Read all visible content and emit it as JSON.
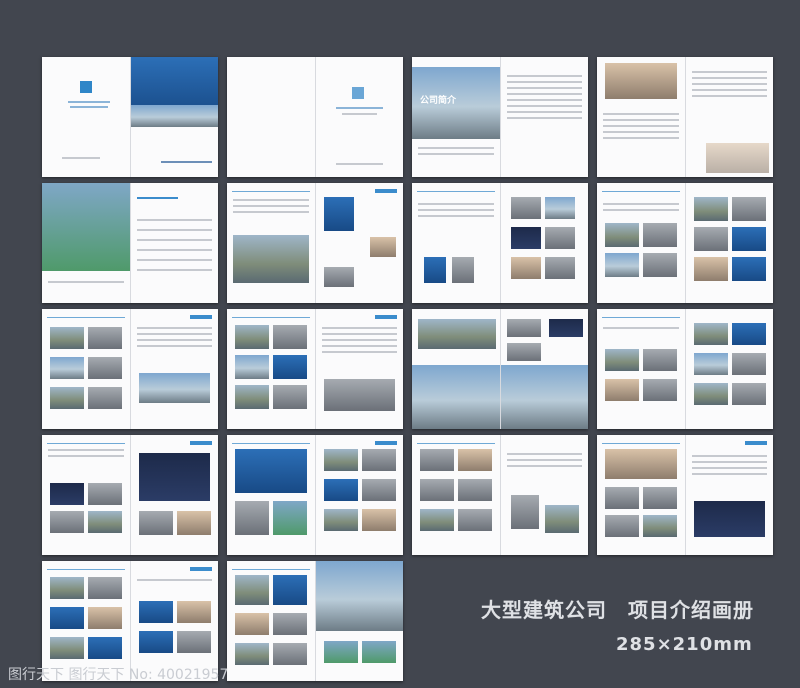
{
  "caption": {
    "title": "大型建筑公司　项目介绍画册",
    "size": "285×210mm"
  },
  "watermark": "图行天下 图行天下 No: 40021957",
  "intro_page_label": "公司简介",
  "colors": {
    "background": "#42464f",
    "accent": "#2f86c8",
    "page": "#fbfbfc"
  }
}
